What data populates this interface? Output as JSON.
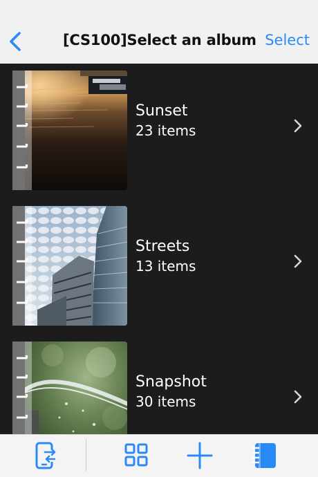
{
  "navbar": {
    "back_icon": "chevron-left-icon",
    "title": "[CS100]Select an album",
    "select_label": "Select"
  },
  "colors": {
    "accent": "#2a8af5",
    "list_background": "#1c1c1c",
    "nav_background": "#f1f1f2"
  },
  "albums": [
    {
      "name": "Sunset",
      "count": "23 items",
      "cover": "sunset-over-water"
    },
    {
      "name": "Streets",
      "count": "13 items",
      "cover": "skyscrapers-under-cloudy-sky"
    },
    {
      "name": "Snapshot",
      "count": "30 items",
      "cover": "fountain-water-splash"
    }
  ],
  "toolbar": {
    "items": [
      {
        "icon": "phone-transfer-icon"
      },
      {
        "icon": "grid-view-icon"
      },
      {
        "icon": "plus-icon"
      },
      {
        "icon": "album-book-icon"
      }
    ]
  }
}
